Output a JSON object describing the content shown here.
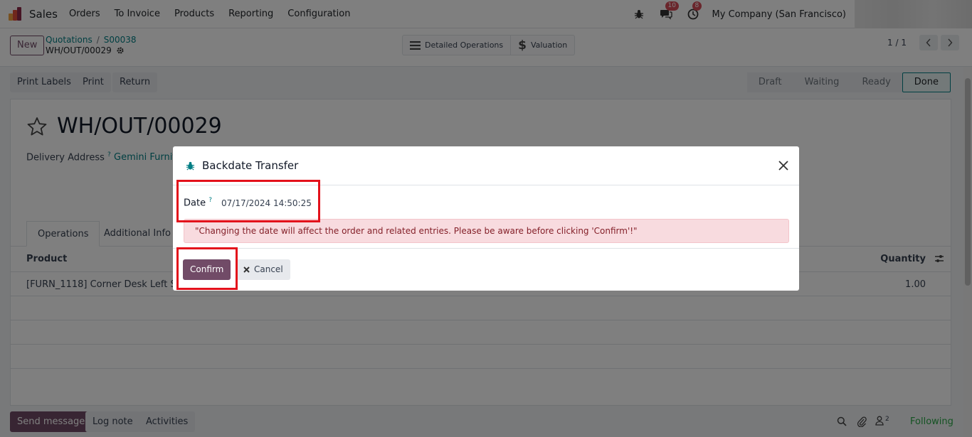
{
  "navbar": {
    "app_name": "Sales",
    "menu": [
      "Orders",
      "To Invoice",
      "Products",
      "Reporting",
      "Configuration"
    ],
    "messages_badge": "10",
    "activities_badge": "8",
    "company": "My Company (San Francisco)"
  },
  "control": {
    "new_label": "New",
    "breadcrumb": [
      "Quotations",
      "S00038"
    ],
    "current_record": "WH/OUT/00029",
    "smart_buttons": [
      "Detailed Operations",
      "Valuation"
    ],
    "pager": "1 / 1"
  },
  "actions": {
    "print_labels": "Print Labels",
    "print": "Print",
    "return": "Return"
  },
  "status_stages": [
    "Draft",
    "Waiting",
    "Ready",
    "Done"
  ],
  "active_stage": "Done",
  "record": {
    "title": "WH/OUT/00029",
    "delivery_label": "Delivery Address",
    "delivery_help": "?",
    "delivery_value": "Gemini Furnitu"
  },
  "tabs": [
    "Operations",
    "Additional Info"
  ],
  "table": {
    "headers": {
      "product": "Product",
      "quantity": "Quantity"
    },
    "rows": [
      {
        "product": "[FURN_1118] Corner Desk Left Sit",
        "quantity": "1.00"
      }
    ]
  },
  "chatter": {
    "send_message": "Send message",
    "log_note": "Log note",
    "activities": "Activities",
    "followers_count": "2",
    "following": "Following"
  },
  "dialog": {
    "title": "Backdate Transfer",
    "date_label": "Date",
    "date_help": "?",
    "date_value": "07/17/2024 14:50:25",
    "warning": "\"Changing the date will affect the order and related entries. Please be aware before clicking 'Confirm'!\"",
    "confirm_label": "Confirm",
    "cancel_label": "Cancel"
  },
  "colors": {
    "brand": "#714b67",
    "link": "#017e84",
    "highlight": "#e3111b",
    "alert_bg": "#f8dbdf"
  }
}
